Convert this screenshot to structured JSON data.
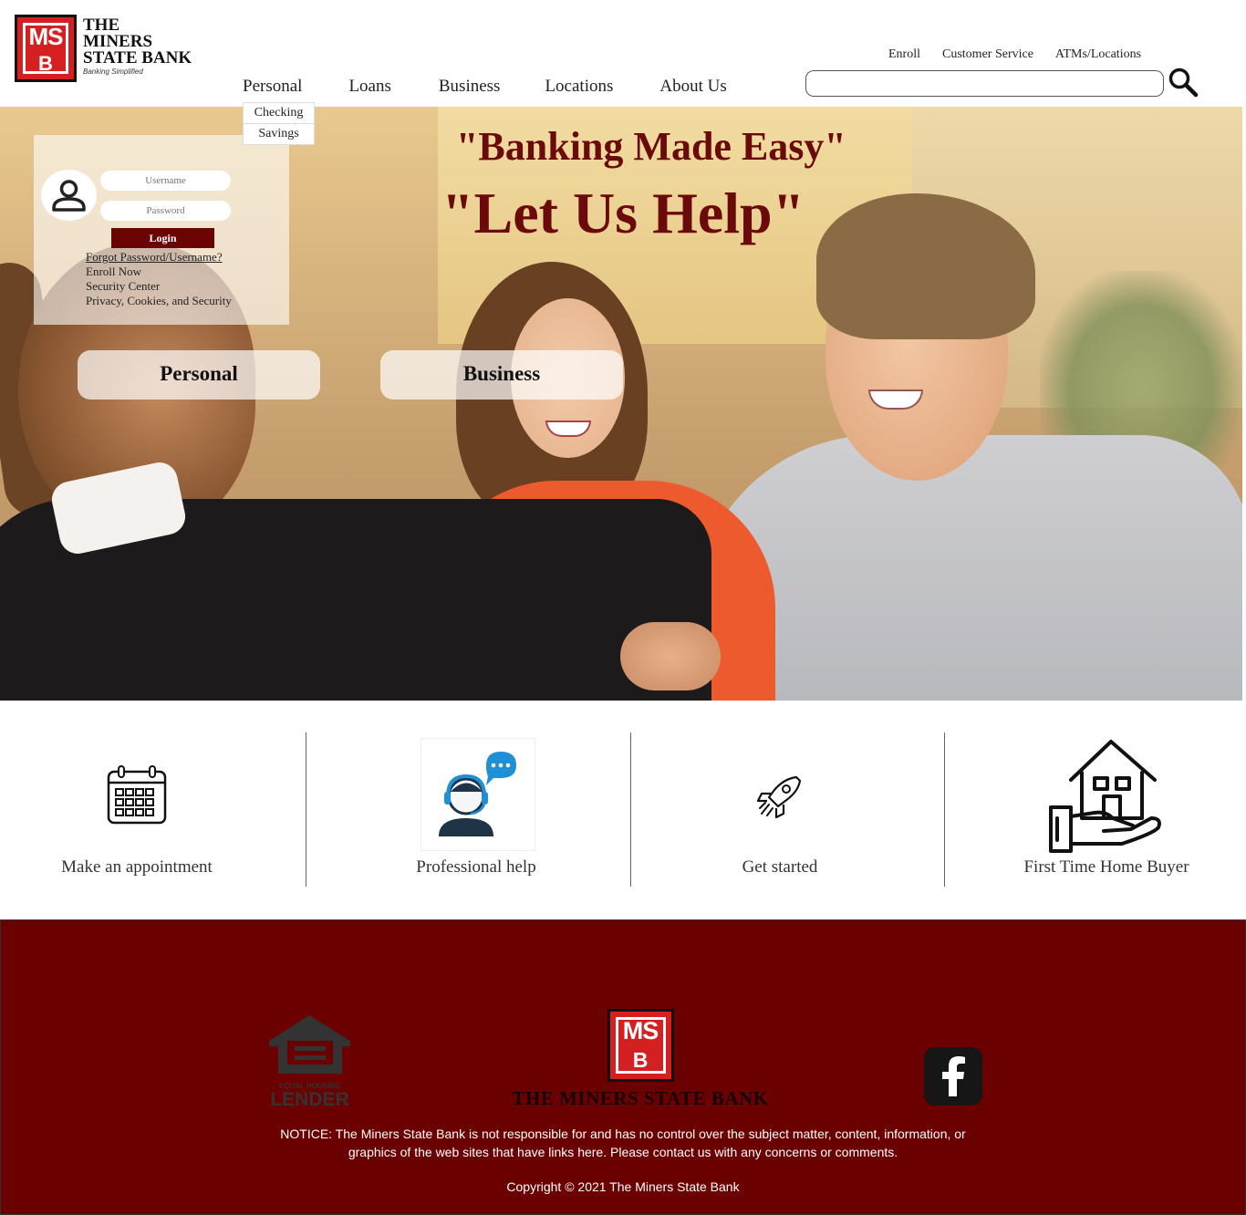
{
  "brand": {
    "line1": "THE",
    "line2": "MINERS",
    "line3": "STATE BANK",
    "tagline": "Banking Simplified",
    "mark_letters": "MS",
    "mark_letter_b": "B",
    "red": "#d42020",
    "maroon": "#6b0000"
  },
  "utility_nav": [
    "Enroll",
    "Customer Service",
    "ATMs/Locations"
  ],
  "main_nav": [
    "Personal",
    "Loans",
    "Business",
    "Locations",
    "About Us"
  ],
  "personal_dropdown": [
    "Checking",
    "Savings"
  ],
  "search": {
    "placeholder": "",
    "icon": "search-icon"
  },
  "hero": {
    "headline1": "\"Banking Made Easy\"",
    "headline2": "\"Let Us Help\"",
    "buttons": {
      "personal": "Personal",
      "business": "Business"
    }
  },
  "login": {
    "username_placeholder": "Username",
    "password_placeholder": "Password",
    "button": "Login",
    "links": {
      "forgot": "Forgot Password/Username?",
      "enroll": "Enroll Now",
      "security": "Security Center",
      "privacy": "Privacy, Cookies, and Security"
    }
  },
  "features": [
    {
      "label": "Make an appointment",
      "icon": "calendar-icon"
    },
    {
      "label": "Professional help",
      "icon": "support-agent-icon"
    },
    {
      "label": "Get started",
      "icon": "rocket-icon"
    },
    {
      "label": "First Time Home Buyer",
      "icon": "home-in-hand-icon"
    }
  ],
  "footer": {
    "ehl_text": "EQUAL HOUSING LENDER",
    "bank_name": "THE MINERS STATE BANK",
    "facebook_icon": "facebook-icon",
    "notice_line1": "NOTICE: The Miners State Bank is not responsible for and has no control over the subject matter, content, information, or",
    "notice_line2": "graphics of the web sites that have links here. Please contact us with any concerns or comments.",
    "copyright": "Copyright © 2021 The Miners State Bank"
  }
}
